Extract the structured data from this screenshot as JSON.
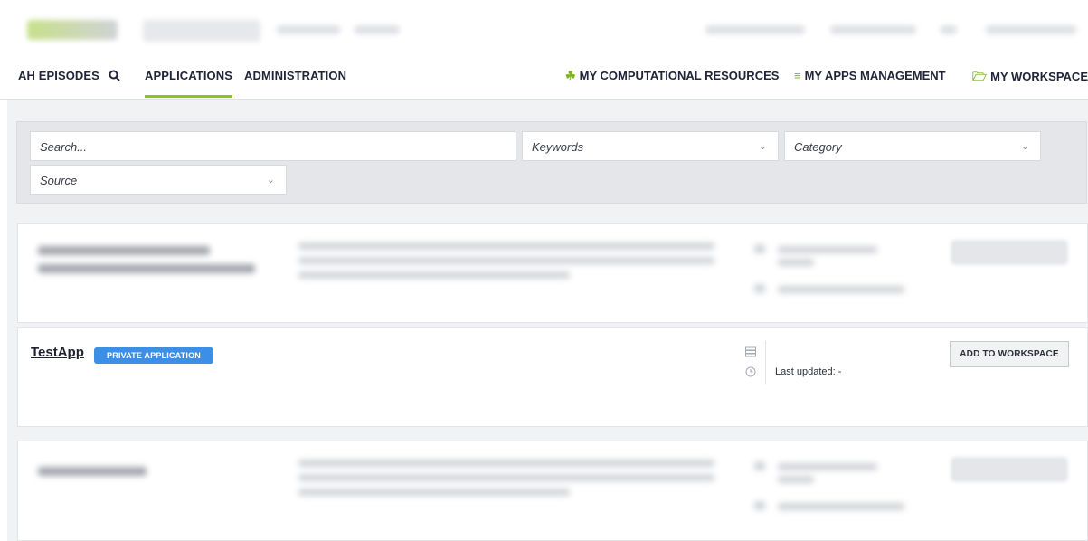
{
  "nav": {
    "items": [
      "AH EPISODES",
      "APPLICATIONS",
      "ADMINISTRATION"
    ],
    "right": [
      {
        "icon": "resources-icon",
        "label": "MY COMPUTATIONAL RESOURCES"
      },
      {
        "icon": "list-icon",
        "label": "MY APPS MANAGEMENT"
      },
      {
        "icon": "folder-icon",
        "label": "MY WORKSPACE"
      }
    ],
    "accent": "#8ec21f"
  },
  "filters": {
    "search_placeholder": "Search...",
    "keywords": "Keywords",
    "category": "Category",
    "source": "Source"
  },
  "app": {
    "title": "TestApp",
    "badge": "PRIVATE APPLICATION",
    "updated": "Last updated: -",
    "button": "ADD TO WORKSPACE",
    "badge_color": "#3d8fe6"
  }
}
